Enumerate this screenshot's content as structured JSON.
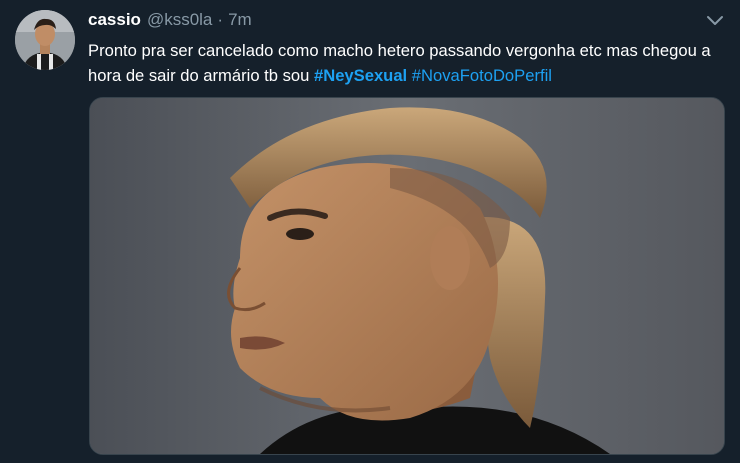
{
  "tweet": {
    "display_name": "cassio",
    "handle": "@kss0la",
    "separator": "·",
    "time": "7m",
    "text_before": "Pronto pra ser cancelado como macho hetero passando vergonha etc mas chegou a hora de sair do armário tb sou ",
    "hashtag_1": "#NeySexual",
    "text_between": " ",
    "hashtag_2": "#NovaFotoDoPerfil",
    "caret_icon": "chevron-down-icon",
    "media_icon": "photo-portrait"
  },
  "colors": {
    "background": "#15202b",
    "text": "#ffffff",
    "secondary": "#8899a6",
    "link": "#1da1f2"
  }
}
